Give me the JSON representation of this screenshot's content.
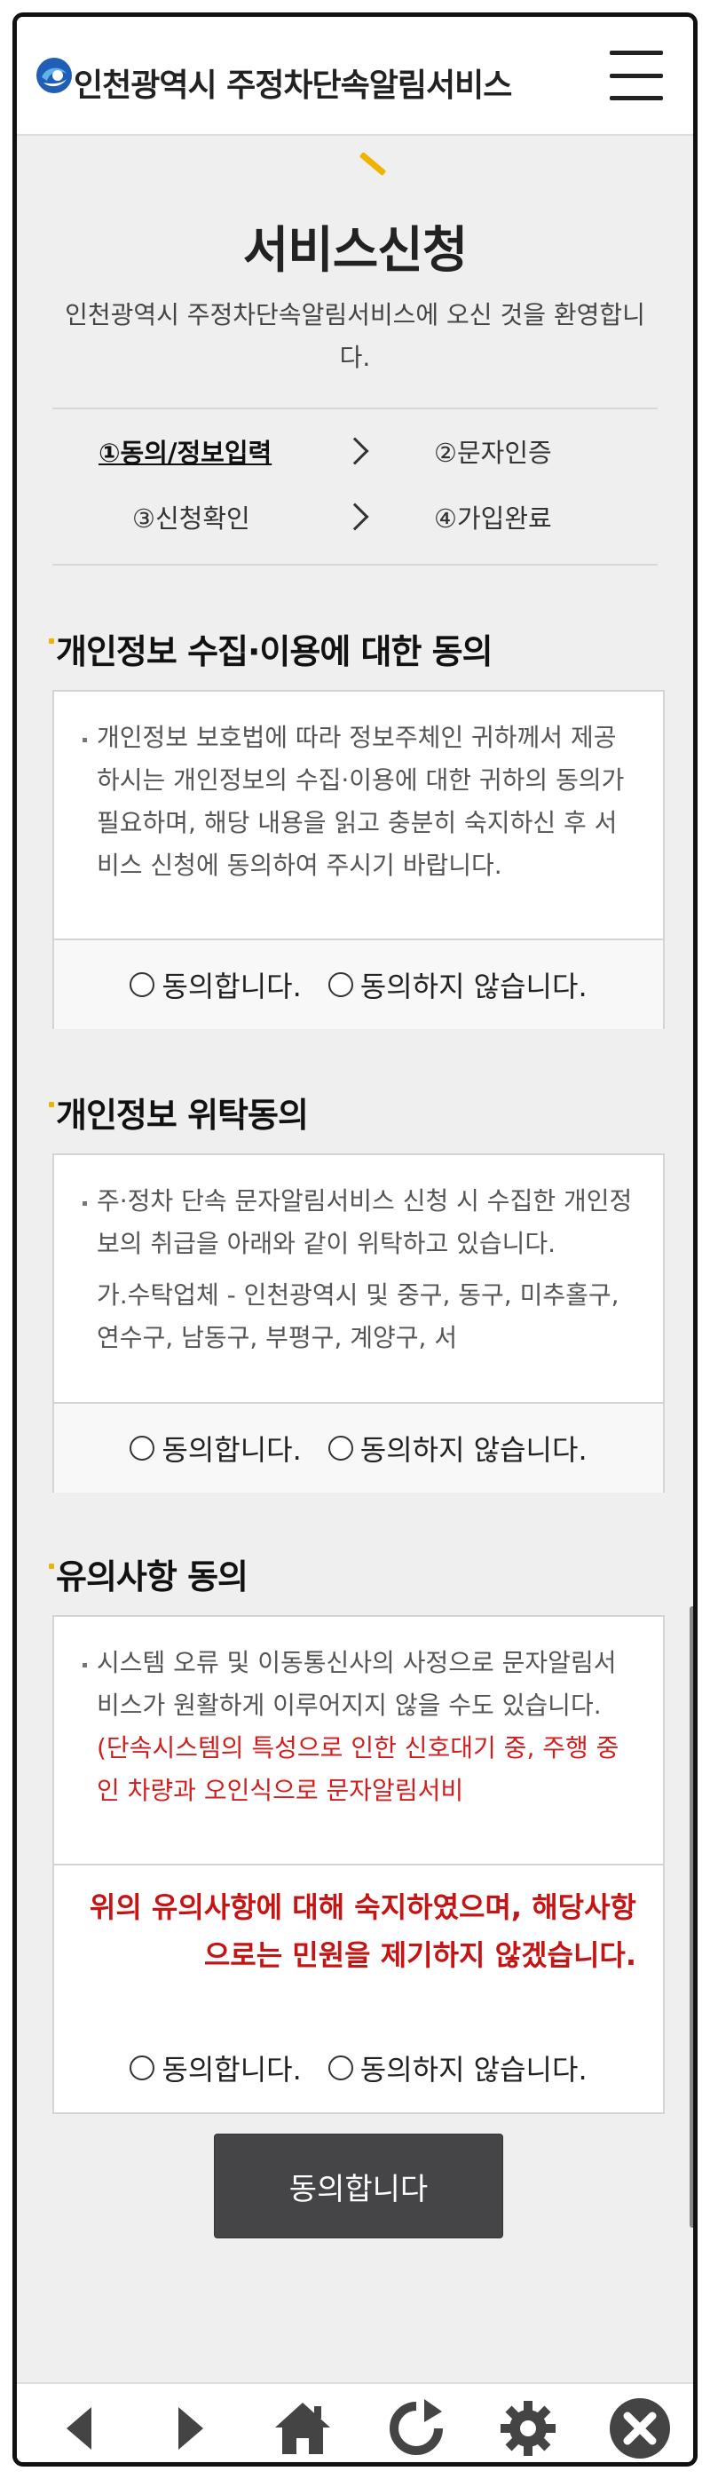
{
  "header": {
    "title": "인천광역시 주정차단속알림서비스",
    "logo_icon": "incheon-logo-icon",
    "menu_icon": "hamburger-menu-icon"
  },
  "page": {
    "title": "서비스신청",
    "welcome": "인천광역시 주정차단속알림서비스에 오신 것을 환영합니다."
  },
  "steps": [
    {
      "label": "①동의/정보입력",
      "active": true
    },
    {
      "label": "②문자인증",
      "active": false
    },
    {
      "label": "③신청확인",
      "active": false
    },
    {
      "label": "④가입완료",
      "active": false
    }
  ],
  "sections": [
    {
      "title": "개인정보 수집·이용에 대한 동의",
      "paragraphs": [
        "개인정보 보호법에 따라 정보주체인 귀하께서 제공하시는 개인정보의 수집·이용에 대한 귀하의 동의가 필요하며, 해당 내용을 읽고 충분히 숙지하신 후 서비스 신청에 동의하여 주시기 바랍니다."
      ],
      "agree_label": "동의합니다.",
      "disagree_label": "동의하지 않습니다."
    },
    {
      "title": "개인정보 위탁동의",
      "paragraphs": [
        "주·정차 단속 문자알림서비스 신청 시 수집한 개인정보의 취급을 아래와 같이 위탁하고 있습니다.",
        "가.수탁업체 - 인천광역시 및 중구, 동구, 미추홀구, 연수구, 남동구, 부평구, 계양구, 서"
      ],
      "agree_label": "동의합니다.",
      "disagree_label": "동의하지 않습니다."
    },
    {
      "title": "유의사항 동의",
      "paragraphs": [
        "시스템 오류 및 이동통신사의 사정으로 문자알림서비스가 원활하게 이루어지지 않을 수도 있습니다."
      ],
      "red_note": "(단속시스템의 특성으로 인한 신호대기 중, 주행 중인 차량과 오인식으로 문자알림서비",
      "notice": "위의 유의사항에 대해 숙지하였으며, 해당사항으로는 민원을 제기하지 않겠습니다.",
      "agree_label": "동의합니다.",
      "disagree_label": "동의하지 않습니다."
    }
  ],
  "submit_label": "동의합니다",
  "toolbar": {
    "icons": [
      "back-arrow-icon",
      "forward-arrow-icon",
      "home-icon",
      "refresh-icon",
      "settings-gear-icon",
      "close-icon"
    ]
  },
  "colors": {
    "accent": "#f0b400",
    "warning": "#c41414",
    "button_bg": "#454548"
  }
}
